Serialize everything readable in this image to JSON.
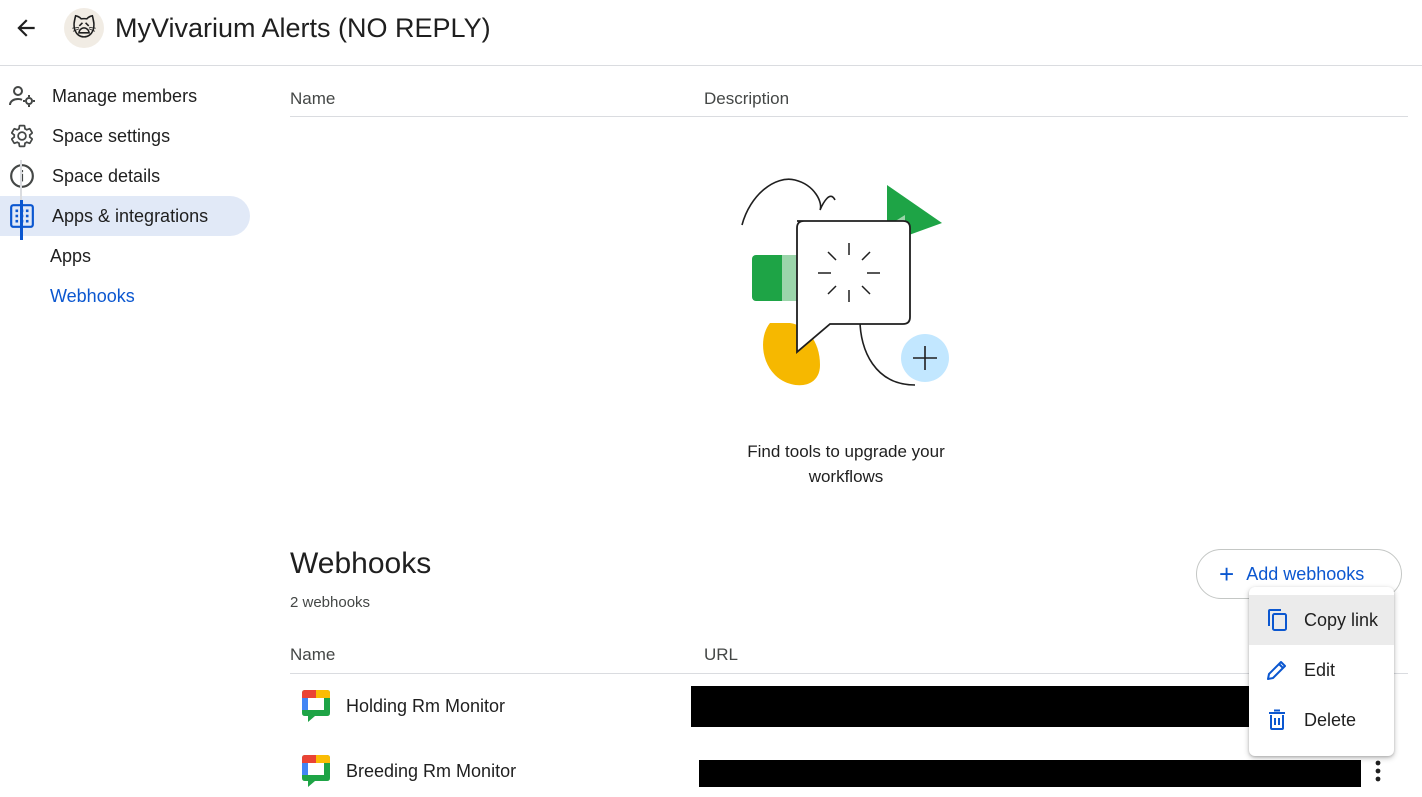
{
  "header": {
    "title": "MyVivarium Alerts (NO REPLY)",
    "back_icon": "arrow-back-icon",
    "avatar_icon": "cat-emoji-avatar"
  },
  "sidebar": {
    "items": [
      {
        "label": "Manage members",
        "icon": "manage-members-icon"
      },
      {
        "label": "Space settings",
        "icon": "gear-icon"
      },
      {
        "label": "Space details",
        "icon": "info-icon"
      },
      {
        "label": "Apps & integrations",
        "icon": "apps-grid-icon"
      }
    ],
    "subitems": [
      {
        "label": "Apps"
      },
      {
        "label": "Webhooks"
      }
    ]
  },
  "apps_table": {
    "columns": [
      "Name",
      "Description"
    ]
  },
  "empty_state": {
    "text": "Find tools to upgrade your workflows"
  },
  "webhooks": {
    "title": "Webhooks",
    "count": "2 webhooks",
    "add_label": "Add webhooks",
    "columns": [
      "Name",
      "URL"
    ],
    "rows": [
      {
        "name": "Holding Rm Monitor"
      },
      {
        "name": "Breeding Rm Monitor"
      }
    ]
  },
  "context_menu": {
    "items": [
      {
        "label": "Copy link",
        "icon": "copy-icon"
      },
      {
        "label": "Edit",
        "icon": "pencil-icon"
      },
      {
        "label": "Delete",
        "icon": "trash-icon"
      }
    ]
  },
  "colors": {
    "accent": "#0b57d0",
    "active_nav_bg": "#e1e9f7",
    "green": "#1ea446",
    "yellow": "#f6b800",
    "light_blue": "#c2e7ff"
  }
}
